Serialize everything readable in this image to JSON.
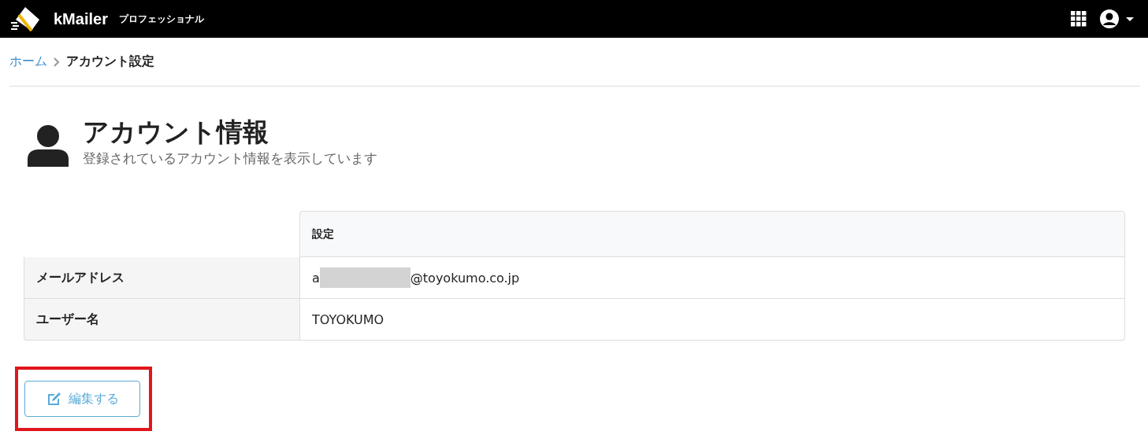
{
  "header": {
    "brand": "kMailer",
    "edition": "プロフェッショナル"
  },
  "breadcrumb": [
    {
      "label": "ホーム",
      "link": true
    },
    {
      "label": "アカウント設定",
      "link": false
    }
  ],
  "page": {
    "title": "アカウント情報",
    "subtitle": "登録されているアカウント情報を表示しています"
  },
  "table": {
    "column_header": "設定",
    "rows": [
      {
        "label": "メールアドレス",
        "value_start": "a",
        "redacted": true,
        "value_end": "@toyokumo.co.jp"
      },
      {
        "label": "ユーザー名",
        "value_start": "TOYOKUMO",
        "redacted": false
      }
    ]
  },
  "edit_button": {
    "label": "編集する",
    "highlighted": true
  }
}
